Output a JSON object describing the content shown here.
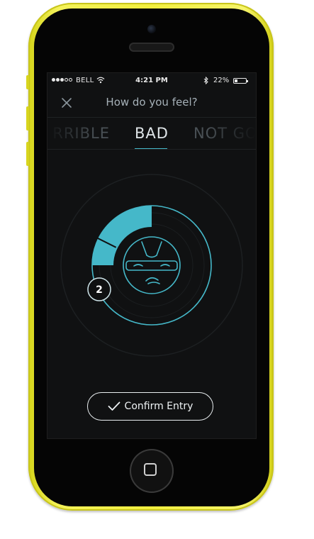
{
  "status_bar": {
    "carrier": "BELL",
    "time": "4:21 PM",
    "battery_percent": "22%",
    "signal_bars_filled": 3,
    "signal_bars_total": 5,
    "battery_level": 0.22
  },
  "header": {
    "title": "How do you feel?",
    "close_icon": "close-icon"
  },
  "mood_tabs": {
    "previous": "RRIBLE",
    "selected": "BAD",
    "next": "NOT GO"
  },
  "mood_dial": {
    "value": "2",
    "face_icon": "sad-face-icon",
    "accent_color": "#45b8c9"
  },
  "actions": {
    "confirm_label": "Confirm Entry",
    "confirm_icon": "check-icon"
  },
  "colors": {
    "background": "#101112",
    "accent": "#45b8c9",
    "phone_body": "#f2ef3f"
  }
}
